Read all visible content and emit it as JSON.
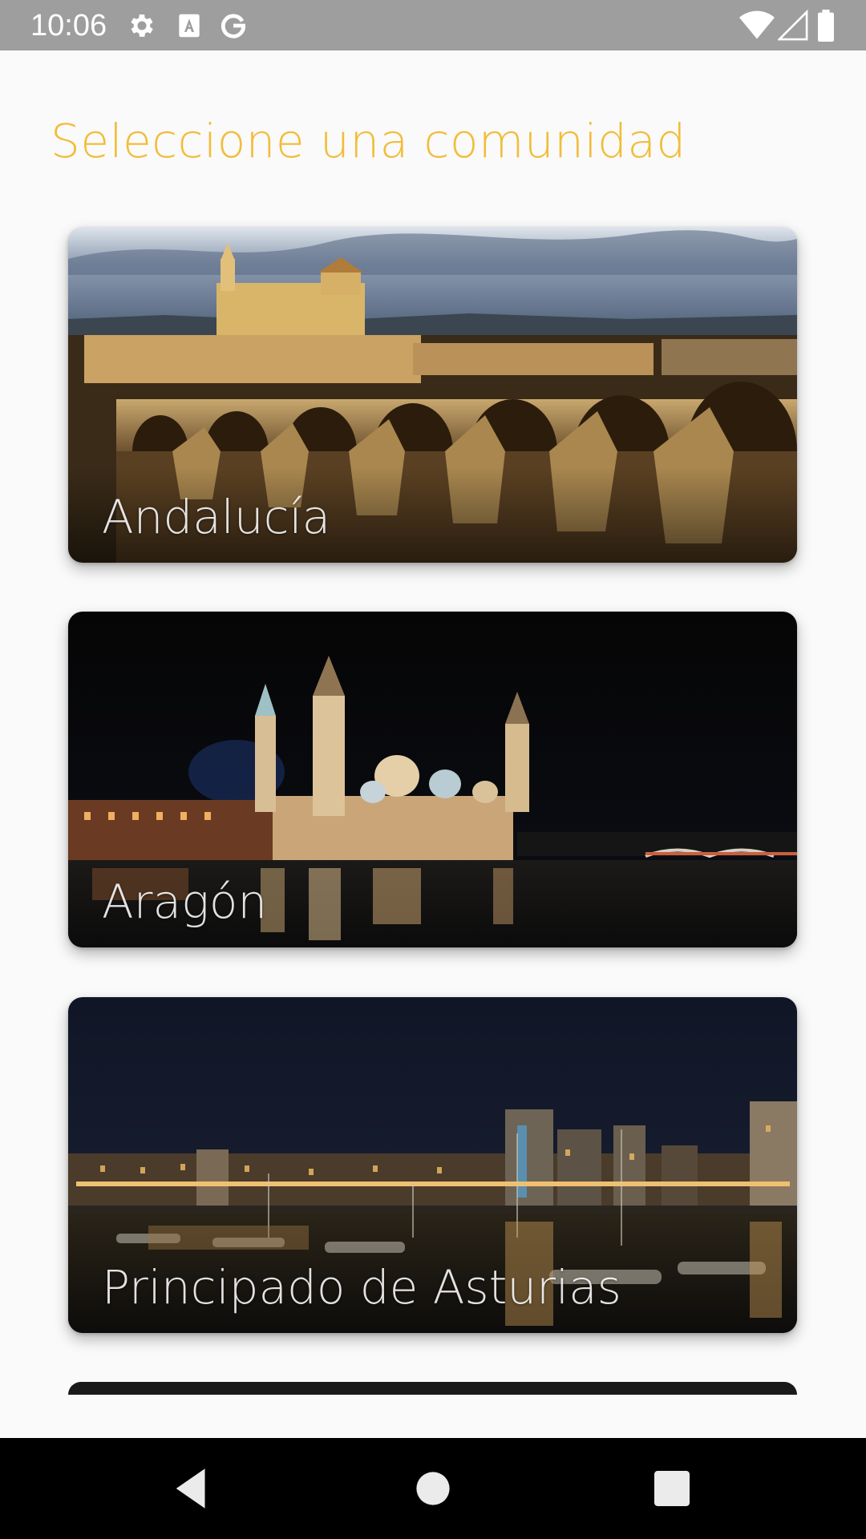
{
  "status_bar": {
    "time": "10:06",
    "icons_left": [
      "settings-gear-icon",
      "font-a-icon",
      "google-g-icon"
    ],
    "icons_right": [
      "wifi-icon",
      "signal-icon",
      "battery-icon"
    ]
  },
  "header": {
    "title": "Seleccione una comunidad"
  },
  "communities": [
    {
      "label": "Andalucía",
      "image": "cordoba-roman-bridge-mezquita-dusk"
    },
    {
      "label": "Aragón",
      "image": "zaragoza-basilica-pilar-night"
    },
    {
      "label": "Principado de Asturias",
      "image": "gijon-marina-night"
    }
  ],
  "colors": {
    "title": "#f1bd3a",
    "background": "#fafafa",
    "status_bar": "#9e9e9e",
    "nav_bar": "#000000"
  },
  "nav_bar": {
    "buttons": [
      "back-icon",
      "home-icon",
      "recents-icon"
    ]
  }
}
